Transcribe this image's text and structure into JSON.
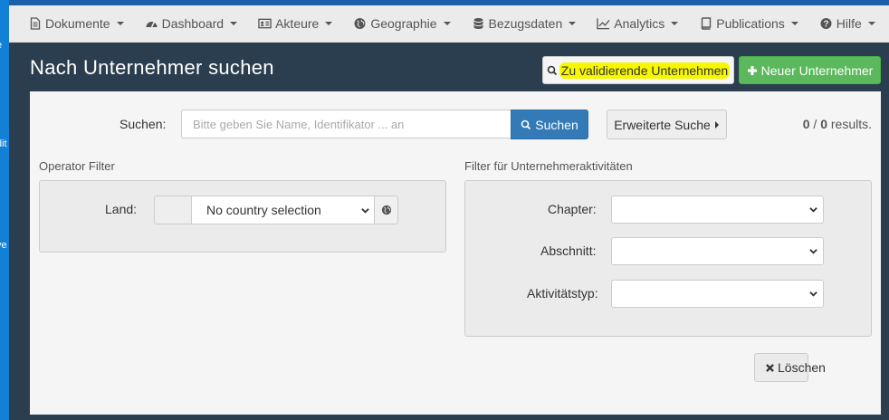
{
  "desktop": {
    "fragments": [
      "e",
      "dit",
      "ye"
    ]
  },
  "nav": {
    "items": [
      {
        "label": "Dokumente",
        "icon": "document-icon"
      },
      {
        "label": "Dashboard",
        "icon": "dashboard-icon"
      },
      {
        "label": "Akteure",
        "icon": "id-card-icon"
      },
      {
        "label": "Geographie",
        "icon": "globe-icon"
      },
      {
        "label": "Bezugsdaten",
        "icon": "database-icon"
      },
      {
        "label": "Analytics",
        "icon": "line-chart-icon"
      },
      {
        "label": "Publications",
        "icon": "book-icon"
      },
      {
        "label": "Hilfe",
        "icon": "question-circle-icon"
      }
    ]
  },
  "header": {
    "title": "Nach Unternehmer suchen",
    "validate_label": "Zu validierende Unternehmen",
    "new_label": "Neuer Unternehmer"
  },
  "search": {
    "label": "Suchen:",
    "placeholder": "Bitte geben Sie Name, Identifikator ... an",
    "button": "Suchen",
    "advanced": "Erweiterte Suche",
    "count": "0",
    "total": "0",
    "results_suffix": "results."
  },
  "operator_filter": {
    "title": "Operator Filter",
    "land_label": "Land:",
    "land_value": "No country selection"
  },
  "activity_filter": {
    "title": "Filter für Unternehmeraktivitäten",
    "chapter_label": "Chapter:",
    "abschnitt_label": "Abschnitt:",
    "typ_label": "Aktivitätstyp:"
  },
  "clear_label": "Löschen",
  "colors": {
    "navbar": "#ebebeb",
    "header_bg": "#2b3e50",
    "primary": "#337ab7",
    "success": "#5cb85c",
    "highlight": "#f7f700"
  }
}
